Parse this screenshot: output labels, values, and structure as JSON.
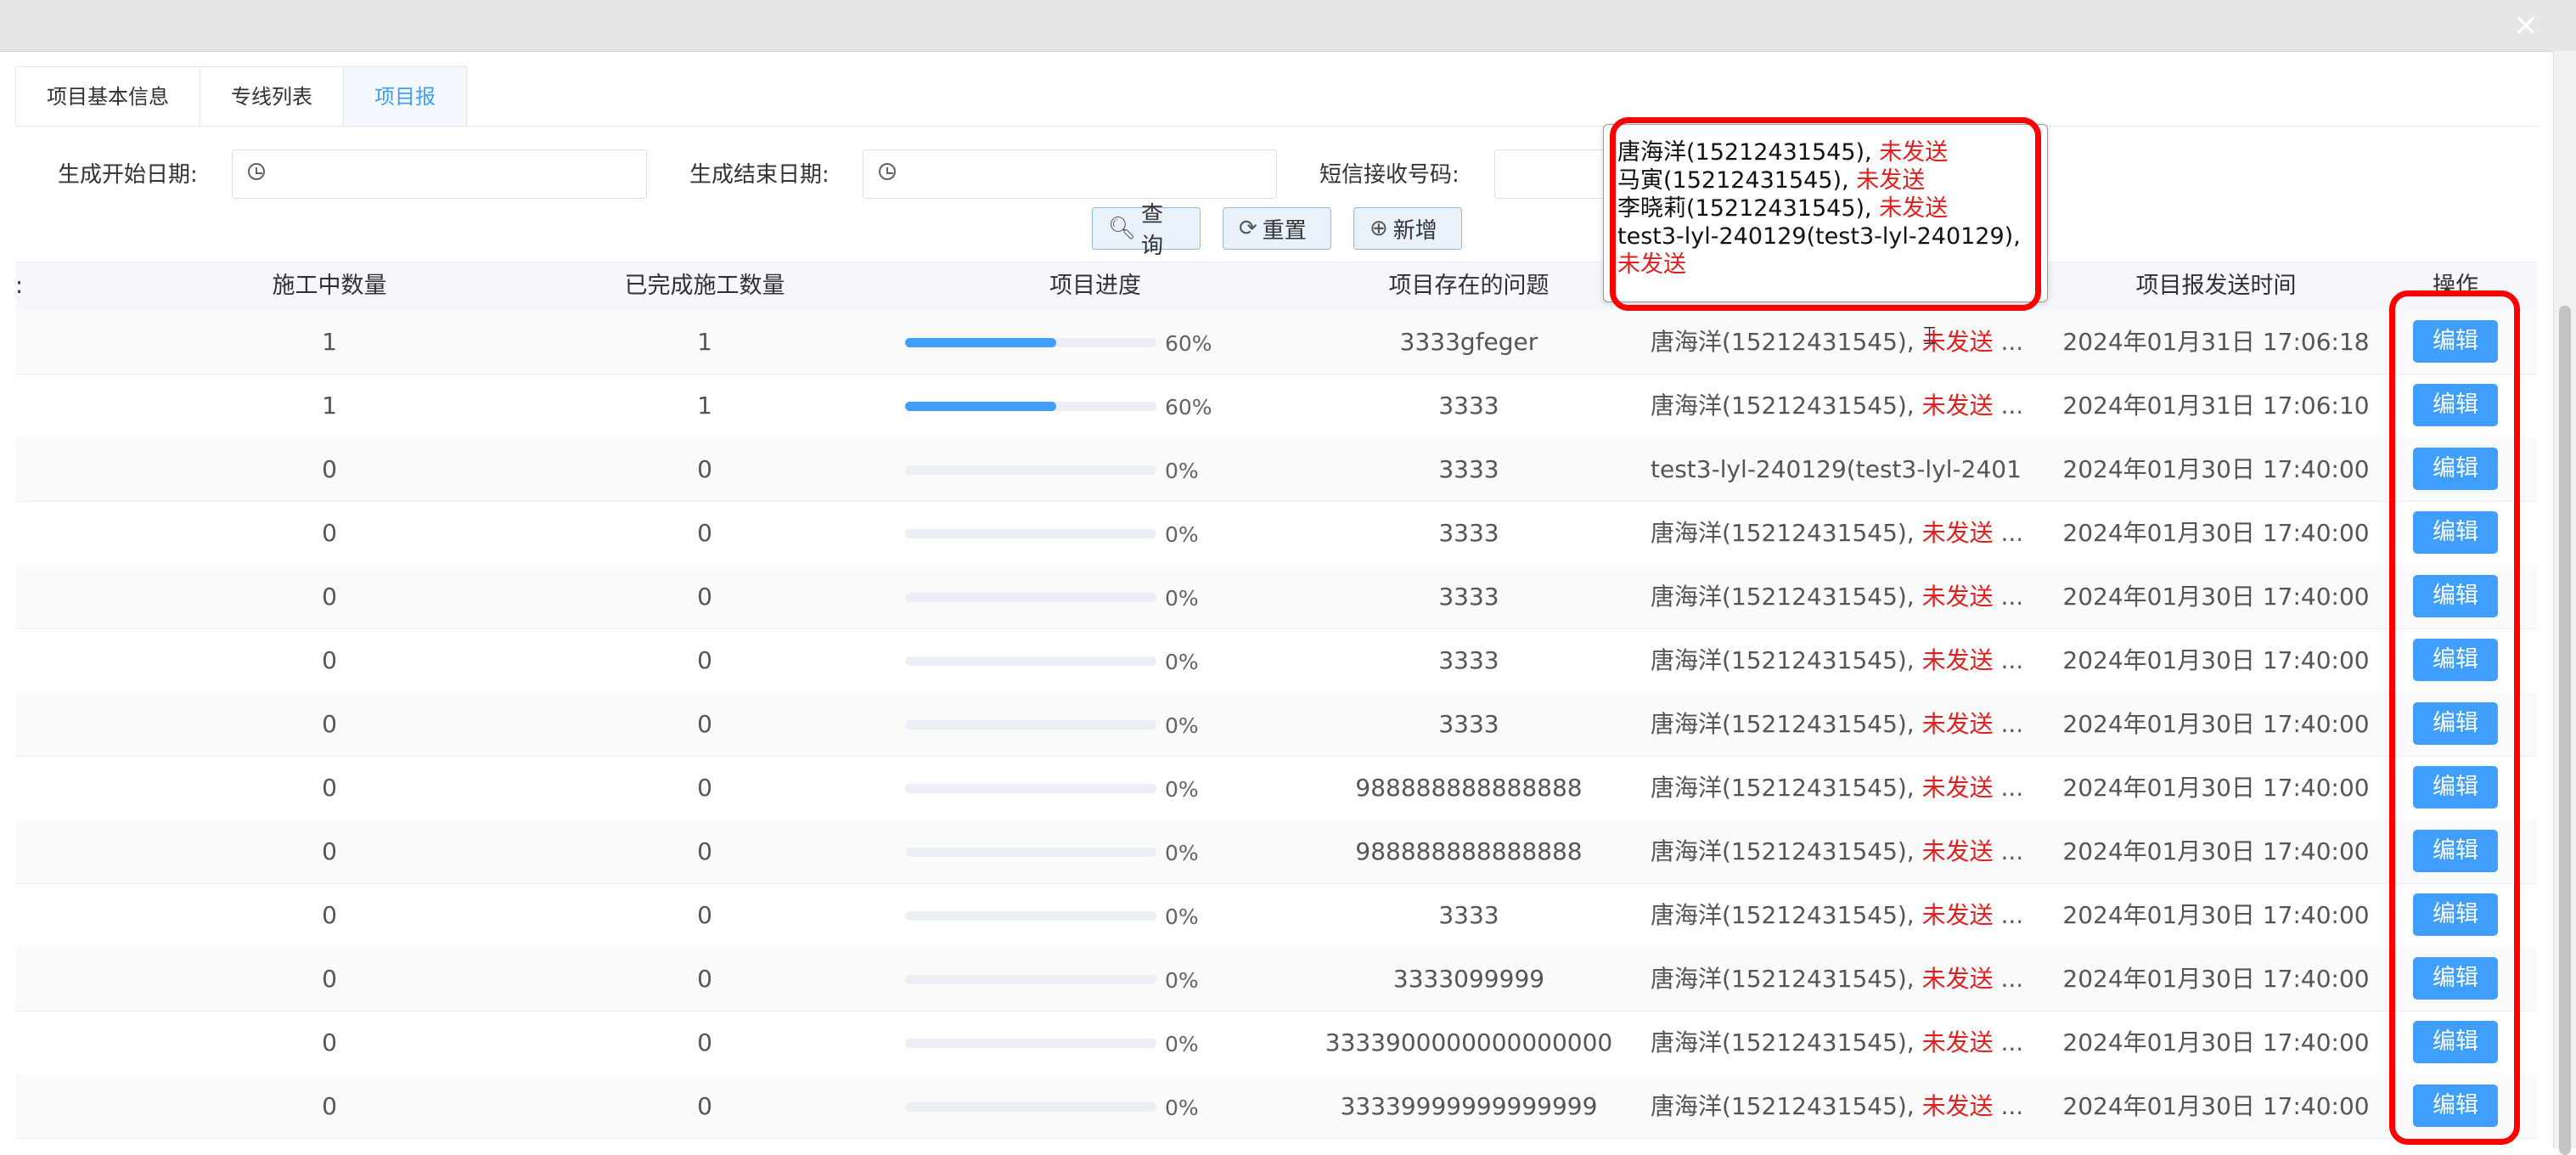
{
  "window": {
    "close_label": "×"
  },
  "tabs": [
    {
      "label": "项目基本信息",
      "active": false
    },
    {
      "label": "专线列表",
      "active": false
    },
    {
      "label": "项目报",
      "active": true
    }
  ],
  "filters": {
    "start_date_label": "生成开始日期:",
    "end_date_label": "生成结束日期:",
    "phone_label": "短信接收号码:",
    "start_date_value": "",
    "end_date_value": "",
    "phone_value": ""
  },
  "buttons": {
    "search": "查询",
    "reset": "重置",
    "add": "新增"
  },
  "table": {
    "columns": {
      "truncated": ":",
      "in_progress": "施工中数量",
      "completed": "已完成施工数量",
      "progress": "项目进度",
      "issues": "项目存在的问题",
      "recipients": "",
      "send_time": "项目报发送时间",
      "actions": "操作"
    },
    "edit_label": "编辑",
    "rows": [
      {
        "in_progress": "1",
        "completed": "1",
        "progress_pct": 60,
        "progress_text": "60%",
        "issues": "3333gfeger",
        "recv_name": "唐海洋(15212431545), ",
        "recv_status": "未发送",
        "recv_more": " ...",
        "send_time": "2024年01月31日 17:06:18"
      },
      {
        "in_progress": "1",
        "completed": "1",
        "progress_pct": 60,
        "progress_text": "60%",
        "issues": "3333",
        "recv_name": "唐海洋(15212431545), ",
        "recv_status": "未发送",
        "recv_more": " ...",
        "send_time": "2024年01月31日 17:06:10"
      },
      {
        "in_progress": "0",
        "completed": "0",
        "progress_pct": 0,
        "progress_text": "0%",
        "issues": "3333",
        "recv_name": "test3-lyl-240129(test3-lyl-2401",
        "recv_status": "",
        "recv_more": "",
        "send_time": "2024年01月30日 17:40:00"
      },
      {
        "in_progress": "0",
        "completed": "0",
        "progress_pct": 0,
        "progress_text": "0%",
        "issues": "3333",
        "recv_name": "唐海洋(15212431545), ",
        "recv_status": "未发送",
        "recv_more": " ...",
        "send_time": "2024年01月30日 17:40:00"
      },
      {
        "in_progress": "0",
        "completed": "0",
        "progress_pct": 0,
        "progress_text": "0%",
        "issues": "3333",
        "recv_name": "唐海洋(15212431545), ",
        "recv_status": "未发送",
        "recv_more": " ...",
        "send_time": "2024年01月30日 17:40:00"
      },
      {
        "in_progress": "0",
        "completed": "0",
        "progress_pct": 0,
        "progress_text": "0%",
        "issues": "3333",
        "recv_name": "唐海洋(15212431545), ",
        "recv_status": "未发送",
        "recv_more": " ...",
        "send_time": "2024年01月30日 17:40:00"
      },
      {
        "in_progress": "0",
        "completed": "0",
        "progress_pct": 0,
        "progress_text": "0%",
        "issues": "3333",
        "recv_name": "唐海洋(15212431545), ",
        "recv_status": "未发送",
        "recv_more": " ...",
        "send_time": "2024年01月30日 17:40:00"
      },
      {
        "in_progress": "0",
        "completed": "0",
        "progress_pct": 0,
        "progress_text": "0%",
        "issues": "988888888888888",
        "recv_name": "唐海洋(15212431545), ",
        "recv_status": "未发送",
        "recv_more": " ...",
        "send_time": "2024年01月30日 17:40:00"
      },
      {
        "in_progress": "0",
        "completed": "0",
        "progress_pct": 0,
        "progress_text": "0%",
        "issues": "988888888888888",
        "recv_name": "唐海洋(15212431545), ",
        "recv_status": "未发送",
        "recv_more": " ...",
        "send_time": "2024年01月30日 17:40:00"
      },
      {
        "in_progress": "0",
        "completed": "0",
        "progress_pct": 0,
        "progress_text": "0%",
        "issues": "3333",
        "recv_name": "唐海洋(15212431545), ",
        "recv_status": "未发送",
        "recv_more": " ...",
        "send_time": "2024年01月30日 17:40:00"
      },
      {
        "in_progress": "0",
        "completed": "0",
        "progress_pct": 0,
        "progress_text": "0%",
        "issues": "3333099999",
        "recv_name": "唐海洋(15212431545), ",
        "recv_status": "未发送",
        "recv_more": " ...",
        "send_time": "2024年01月30日 17:40:00"
      },
      {
        "in_progress": "0",
        "completed": "0",
        "progress_pct": 0,
        "progress_text": "0%",
        "issues": "3333900000000000000",
        "recv_name": "唐海洋(15212431545), ",
        "recv_status": "未发送",
        "recv_more": " ...",
        "send_time": "2024年01月30日 17:40:00"
      },
      {
        "in_progress": "0",
        "completed": "0",
        "progress_pct": 0,
        "progress_text": "0%",
        "issues": "33339999999999999",
        "recv_name": "唐海洋(15212431545), ",
        "recv_status": "未发送",
        "recv_more": " ...",
        "send_time": "2024年01月30日 17:40:00"
      }
    ]
  },
  "tooltip": {
    "lines": [
      {
        "name": "唐海洋(15212431545), ",
        "status": "未发送"
      },
      {
        "name": "马寅(15212431545), ",
        "status": "未发送"
      },
      {
        "name": "李晓莉(15212431545), ",
        "status": "未发送"
      },
      {
        "name": "test3-lyl-240129(test3-lyl-240129), ",
        "status": ""
      },
      {
        "name": "",
        "status": "未发送"
      }
    ]
  },
  "colors": {
    "accent": "#409eff",
    "status_red": "#e02020",
    "highlight": "#ff0000"
  }
}
